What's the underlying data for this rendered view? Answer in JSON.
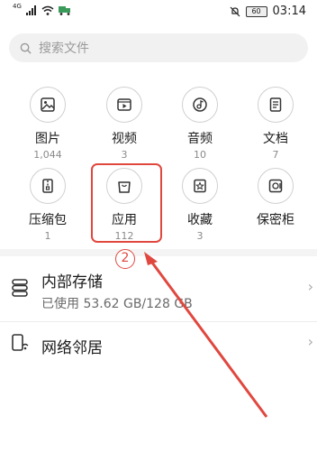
{
  "status_bar": {
    "signal": "4G",
    "battery": "60",
    "time": "03:14"
  },
  "search": {
    "placeholder": "搜索文件"
  },
  "categories": [
    {
      "label": "图片",
      "count": "1,044",
      "icon": "image-icon"
    },
    {
      "label": "视频",
      "count": "3",
      "icon": "video-icon"
    },
    {
      "label": "音频",
      "count": "10",
      "icon": "audio-icon"
    },
    {
      "label": "文档",
      "count": "7",
      "icon": "document-icon"
    },
    {
      "label": "压缩包",
      "count": "1",
      "icon": "archive-icon"
    },
    {
      "label": "应用",
      "count": "112",
      "icon": "shopping-bag-icon"
    },
    {
      "label": "收藏",
      "count": "3",
      "icon": "star-bookmark-icon"
    },
    {
      "label": "保密柜",
      "count": "",
      "icon": "safe-icon"
    }
  ],
  "storage": {
    "title": "内部存储",
    "usage": "已使用 53.62 GB/128 GB"
  },
  "network": {
    "title": "网络邻居"
  },
  "annotation": {
    "step_number": "2",
    "color": "#e0483f"
  }
}
